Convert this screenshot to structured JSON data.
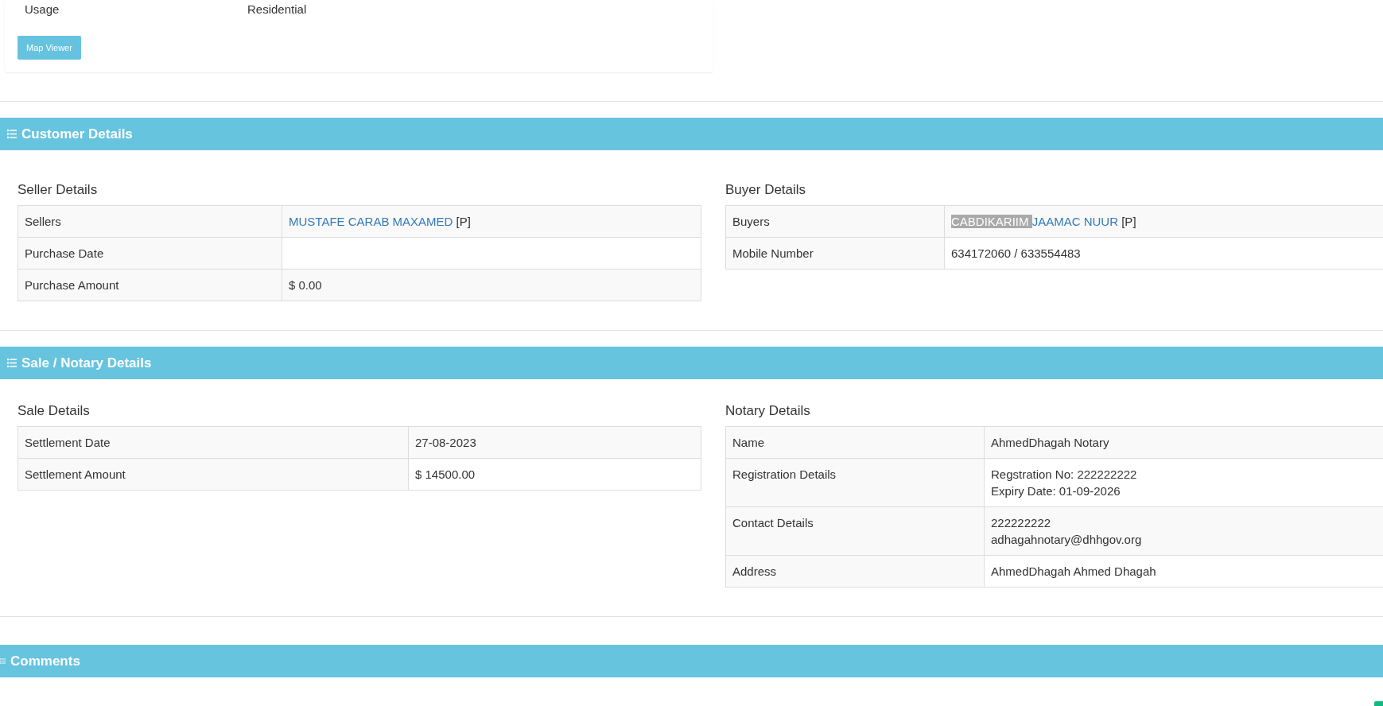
{
  "property": {
    "rows": [
      {
        "label": "Usage",
        "value": "Residential"
      }
    ],
    "button": "Map Viewer"
  },
  "sections": [
    {
      "title": "Customer Details",
      "panels": [
        {
          "title": "Seller Details",
          "rows": [
            {
              "label": "Sellers",
              "kind": "person",
              "parts": [
                {
                  "text": "MUSTAFE CARAB MAXAMED",
                  "selected": false
                }
              ],
              "suffix": "[P]"
            },
            {
              "label": "Purchase Date",
              "kind": "text",
              "lines": []
            },
            {
              "label": "Purchase Amount",
              "kind": "text",
              "lines": [
                "$ 0.00"
              ]
            }
          ]
        },
        {
          "title": "Buyer Details",
          "rows": [
            {
              "label": "Buyers",
              "kind": "person",
              "parts": [
                {
                  "text": "CABDIKARIIM ",
                  "selected": true
                },
                {
                  "text": "JAAMAC NUUR",
                  "selected": false
                }
              ],
              "suffix": "[P]"
            },
            {
              "label": "Mobile Number",
              "kind": "text",
              "lines": [
                "634172060 / 633554483"
              ]
            }
          ]
        }
      ]
    },
    {
      "title": "Sale / Notary Details",
      "panels": [
        {
          "title": "Sale Details",
          "rows": [
            {
              "label": "Settlement Date",
              "kind": "text",
              "lines": [
                "27-08-2023"
              ]
            },
            {
              "label": "Settlement Amount",
              "kind": "text",
              "lines": [
                "$ 14500.00"
              ]
            }
          ]
        },
        {
          "title": "Notary Details",
          "rows": [
            {
              "label": "Name",
              "kind": "text",
              "lines": [
                "AhmedDhagah Notary"
              ]
            },
            {
              "label": "Registration Details",
              "kind": "text",
              "lines": [
                "Regstration No: 222222222",
                "Expiry Date: 01-09-2026"
              ]
            },
            {
              "label": "Contact Details",
              "kind": "text",
              "lines": [
                "222222222",
                "adhagahnotary@dhhgov.org"
              ]
            },
            {
              "label": "Address",
              "kind": "text",
              "lines": [
                "AhmedDhagah Ahmed Dhagah"
              ]
            }
          ]
        }
      ]
    },
    {
      "title": "Comments"
    }
  ]
}
